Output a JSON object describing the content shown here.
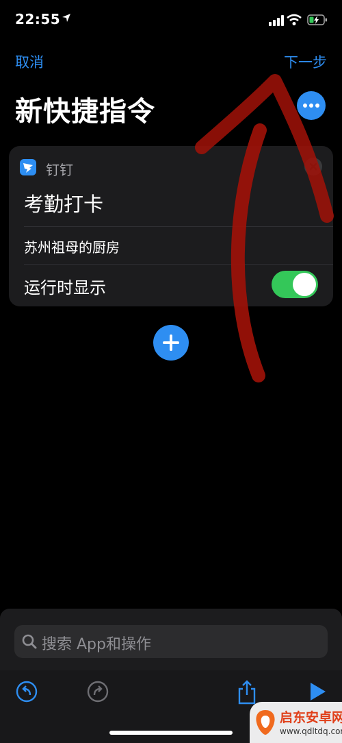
{
  "status_bar": {
    "time": "22:55"
  },
  "nav": {
    "cancel_label": "取消",
    "next_label": "下一步"
  },
  "title": "新快捷指令",
  "action_card": {
    "app_name": "钉钉",
    "action_title": "考勤打卡",
    "parameter_value": "苏州祖母的厨房",
    "toggle_label": "运行时显示",
    "toggle_on": true
  },
  "search": {
    "placeholder": "搜索 App和操作"
  },
  "toolbar": {
    "icons": [
      "undo-icon",
      "redo-icon",
      "share-icon",
      "play-icon"
    ]
  },
  "watermark": {
    "name": "启东安卓网",
    "url": "www.qdltdq.com"
  },
  "colors": {
    "accent": "#2e8ef2",
    "toggle_on": "#34c759",
    "annotation": "#a11208"
  }
}
